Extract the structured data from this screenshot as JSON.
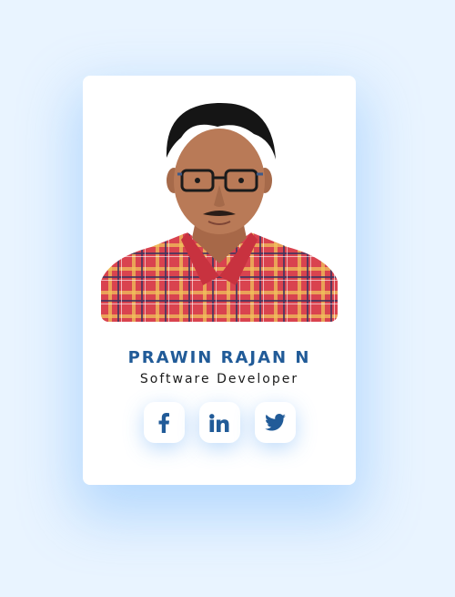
{
  "profile": {
    "name": "PRAWIN RAJAN N",
    "role": "Software Developer",
    "photo_alt": "profile-photo"
  },
  "social": [
    {
      "network": "facebook",
      "icon": "facebook-icon"
    },
    {
      "network": "linkedin",
      "icon": "linkedin-icon"
    },
    {
      "network": "twitter",
      "icon": "twitter-icon"
    }
  ],
  "colors": {
    "background": "#e9f4ff",
    "card": "#ffffff",
    "accent": "#215b98"
  }
}
